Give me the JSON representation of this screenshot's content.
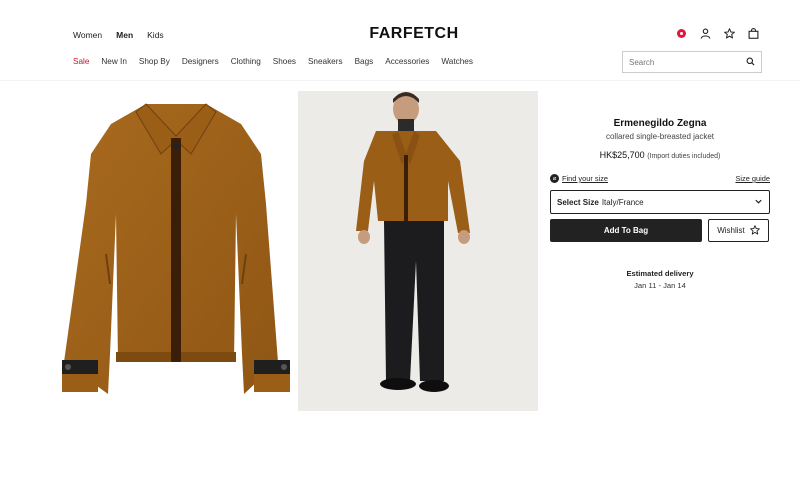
{
  "header": {
    "gender_tabs": [
      "Women",
      "Men",
      "Kids"
    ],
    "active_gender": "Men",
    "logo": "FARFETCH",
    "categories": [
      "Sale",
      "New In",
      "Shop By",
      "Designers",
      "Clothing",
      "Shoes",
      "Sneakers",
      "Bags",
      "Accessories",
      "Watches"
    ],
    "search_placeholder": "Search",
    "icons": [
      "flag-icon",
      "account-icon",
      "wishlist-star-icon",
      "bag-icon",
      "search-icon"
    ],
    "sale_color": "#c8102e"
  },
  "product": {
    "brand": "Ermenegildo Zegna",
    "name": "collared single-breasted jacket",
    "price": "HK$25,700",
    "price_note": "(Import duties included)",
    "find_size": "Find your size",
    "size_guide": "Size guide",
    "select_size_label": "Select Size",
    "select_size_value": "Italy/France",
    "add_to_bag": "Add To Bag",
    "wishlist": "Wishlist",
    "delivery_title": "Estimated delivery",
    "delivery_dates": "Jan 11 - Jan 14",
    "images": [
      "jacket-flat-image",
      "model-wearing-jacket-image"
    ]
  }
}
